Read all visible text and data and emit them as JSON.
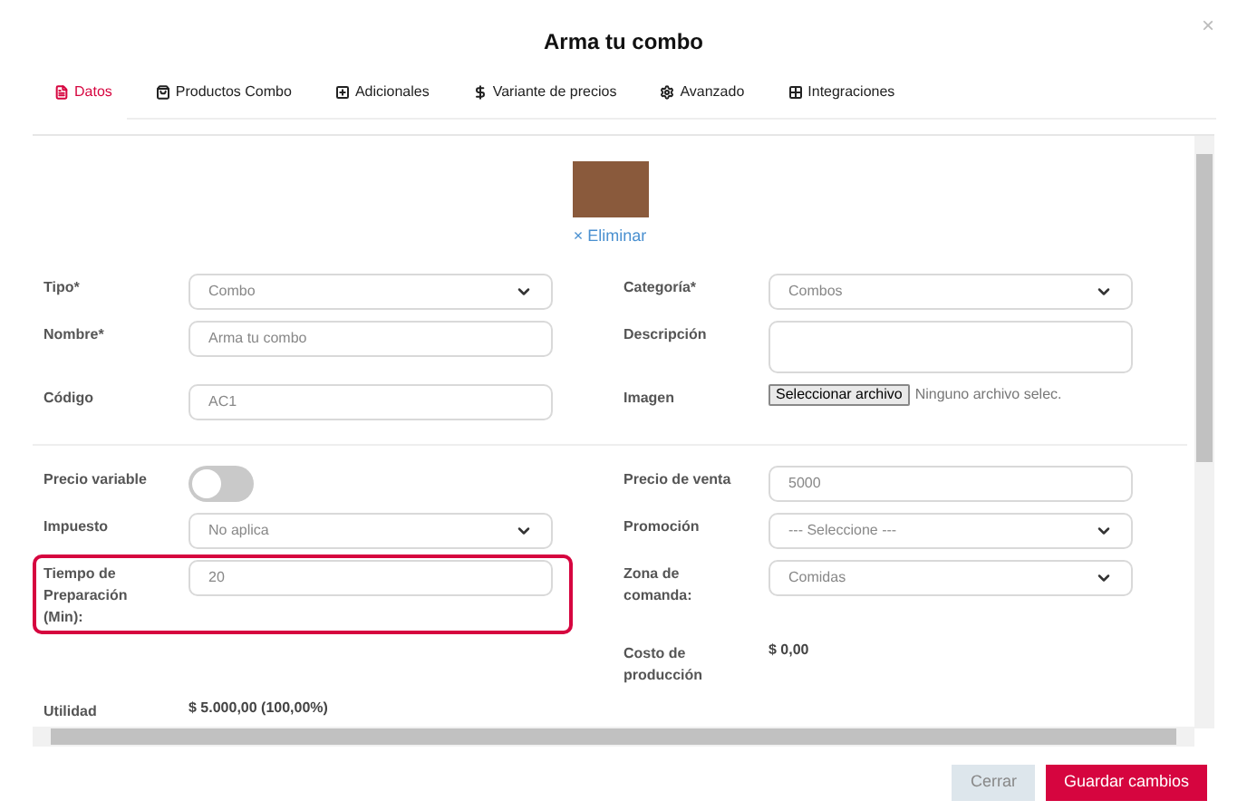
{
  "window": {
    "title": "Arma tu combo",
    "close": "×"
  },
  "tabs": [
    {
      "label": "Datos",
      "selected": true
    },
    {
      "label": "Productos Combo",
      "selected": false
    },
    {
      "label": "Adicionales",
      "selected": false
    },
    {
      "label": "Variante de precios",
      "selected": false
    },
    {
      "label": "Avanzado",
      "selected": false
    },
    {
      "label": "Integraciones",
      "selected": false
    }
  ],
  "image": {
    "remove": "× Eliminar"
  },
  "sections": [
    {
      "rows": [
        {
          "left": {
            "label": "Tipo*",
            "kind": "select",
            "value": "Combo"
          },
          "right": {
            "label": "Categoría*",
            "kind": "select",
            "value": "Combos"
          }
        },
        {
          "left": {
            "label": "Nombre*",
            "kind": "input",
            "value": "Arma tu combo"
          },
          "right": {
            "label": "Descripción",
            "kind": "textarea"
          }
        },
        {
          "left": {
            "label": "Código",
            "kind": "input",
            "value": "AC1"
          },
          "right": {
            "label": "Imagen",
            "kind": "file",
            "button": "Seleccionar archivo",
            "value": "Ninguno archivo selec."
          }
        }
      ]
    },
    {
      "rows": [
        {
          "left": {
            "label": "Precio variable",
            "kind": "toggle",
            "on": false
          },
          "right": {
            "label": "Precio de venta",
            "kind": "input",
            "value": "5000"
          }
        },
        {
          "left": {
            "label": "Impuesto",
            "kind": "select",
            "value": "No aplica"
          },
          "right": {
            "label": "Promoción",
            "kind": "select",
            "value": "--- Seleccione ---"
          }
        },
        {
          "left": {
            "label": "Tiempo de Preparación (Min):",
            "kind": "input",
            "value": "20",
            "highlighted": true
          },
          "right": {
            "label": "Zona de comanda:",
            "kind": "select",
            "value": "Comidas"
          }
        },
        {
          "right": {
            "label": "Costo de producción",
            "kind": "text",
            "value": "$ 0,00"
          }
        },
        {
          "left": {
            "label": "Utilidad",
            "kind": "text",
            "value": "$ 5.000,00 (100,00%)"
          }
        }
      ]
    }
  ],
  "buttons": [
    {
      "label": "Cerrar",
      "kind": "secondary"
    },
    {
      "label": "Guardar cambios",
      "kind": "primary"
    }
  ]
}
